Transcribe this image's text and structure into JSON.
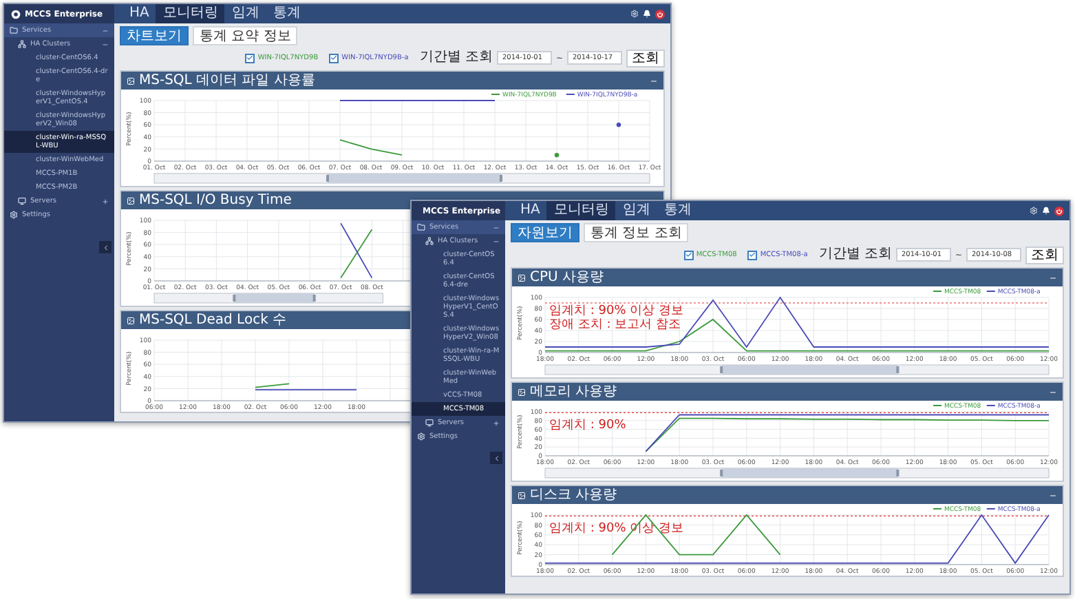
{
  "windows": [
    {
      "logo": "MCCS Enterprise",
      "nav_tabs": [
        {
          "label": "HA",
          "selected": false
        },
        {
          "label": "모니터링",
          "selected": true
        },
        {
          "label": "임계",
          "selected": false
        },
        {
          "label": "통계",
          "selected": false
        }
      ],
      "sidebar": [
        {
          "label": "Services",
          "kind": "section",
          "expanded": true,
          "selected": false,
          "children": [
            {
              "label": "HA Clusters",
              "kind": "group",
              "expanded": true,
              "selected": false,
              "children": [
                {
                  "label": "cluster-CentOS6.4",
                  "kind": "node",
                  "selected": false
                },
                {
                  "label": "cluster-CentOS6.4-dre",
                  "kind": "node",
                  "selected": false
                },
                {
                  "label": "cluster-WindowsHyperV1_CentOS.4",
                  "kind": "node",
                  "selected": false
                },
                {
                  "label": "cluster-WindowsHyperV2_Win08",
                  "kind": "node",
                  "selected": false
                },
                {
                  "label": "cluster-Win-ra-MSSQL-WBU",
                  "kind": "node",
                  "selected": true
                },
                {
                  "label": "cluster-WinWebMed",
                  "kind": "node",
                  "selected": false
                },
                {
                  "label": "MCCS-PM1B",
                  "kind": "node",
                  "selected": false
                },
                {
                  "label": "MCCS-PM2B",
                  "kind": "node",
                  "selected": false
                }
              ]
            },
            {
              "label": "Servers",
              "kind": "device",
              "expanded": false,
              "selected": false
            }
          ]
        },
        {
          "label": "Settings",
          "kind": "link",
          "selected": false
        }
      ],
      "sub_tabs": [
        {
          "label": "차트보기",
          "selected": true
        },
        {
          "label": "통계 요약 정보",
          "selected": false
        }
      ],
      "filters": [
        {
          "label": "WIN-7IQL7NYD9B",
          "checked": true,
          "color": "#3a9a3a"
        },
        {
          "label": "WIN-7IQL7NYD9B-a",
          "checked": true,
          "color": "#4a4ab8"
        }
      ],
      "period_label": "기간별 조회",
      "date_from": "2014-10-01",
      "date_sep": "~",
      "date_to": "2014-10-17",
      "query_button": "조회",
      "panels": [
        {
          "title": "MS-SQL 데이터 파일 사용률",
          "navigator": true,
          "minimize": true,
          "chart_data": {
            "type": "line",
            "ylabel": "Percent(%)",
            "yticks": [
              0,
              20,
              40,
              60,
              80,
              100
            ],
            "ylim": [
              0,
              100
            ],
            "grid": true,
            "legend": "upper right",
            "categories": [
              "01. Oct",
              "02. Oct",
              "03. Oct",
              "04. Oct",
              "05. Oct",
              "06. Oct",
              "07. Oct",
              "08. Oct",
              "09. Oct",
              "10. Oct",
              "11. Oct",
              "12. Oct",
              "13. Oct",
              "14. Oct",
              "15. Oct",
              "16. Oct",
              "17. Oct"
            ],
            "series": [
              {
                "name": "WIN-7IQL7NYD9B",
                "color": "#3a9a3a",
                "values": [
                  null,
                  null,
                  null,
                  null,
                  null,
                  null,
                  35,
                  20,
                  10,
                  null,
                  null,
                  null,
                  null,
                  10,
                  null,
                  null,
                  null
                ]
              },
              {
                "name": "WIN-7IQL7NYD9B-a",
                "color": "#4a4ab8",
                "values": [
                  null,
                  null,
                  null,
                  null,
                  null,
                  null,
                  100,
                  100,
                  100,
                  100,
                  100,
                  100,
                  null,
                  null,
                  null,
                  60,
                  null
                ]
              }
            ]
          }
        },
        {
          "title": "MS-SQL I/O Busy Time",
          "navigator": true,
          "chart_data": {
            "type": "line",
            "ylabel": "Percent(%)",
            "yticks": [
              0,
              20,
              40,
              60,
              80,
              100
            ],
            "ylim": [
              0,
              100
            ],
            "grid": true,
            "categories": [
              "01. Oct",
              "02. Oct",
              "03. Oct",
              "04. Oct",
              "05. Oct",
              "06. Oct",
              "07. Oct",
              "08. Oct"
            ],
            "series": [
              {
                "color": "#3a9a3a",
                "values": [
                  null,
                  null,
                  null,
                  null,
                  null,
                  null,
                  5,
                  85
                ]
              },
              {
                "color": "#4a4ab8",
                "values": [
                  null,
                  null,
                  null,
                  null,
                  null,
                  null,
                  95,
                  5
                ]
              }
            ]
          }
        },
        {
          "title": "MS-SQL Dead Lock 수",
          "chart_data": {
            "type": "line",
            "ylabel": "Percent(%)",
            "yticks": [
              0,
              20,
              40,
              60,
              80,
              100
            ],
            "ylim": [
              0,
              100
            ],
            "grid": true,
            "categories": [
              "06:00",
              "12:00",
              "18:00",
              "02. Oct",
              "06:00",
              "12:00",
              "18:00"
            ],
            "series": [
              {
                "color": "#3a9a3a",
                "values": [
                  null,
                  null,
                  null,
                  22,
                  28,
                  null,
                  null
                ]
              },
              {
                "color": "#4a4ab8",
                "values": [
                  null,
                  null,
                  null,
                  18,
                  18,
                  18,
                  18
                ]
              }
            ]
          }
        }
      ]
    },
    {
      "logo": "MCCS Enterprise",
      "nav_tabs": [
        {
          "label": "HA",
          "selected": false
        },
        {
          "label": "모니터링",
          "selected": true
        },
        {
          "label": "임계",
          "selected": false
        },
        {
          "label": "통계",
          "selected": false
        }
      ],
      "sidebar": [
        {
          "label": "Services",
          "kind": "section",
          "expanded": true,
          "selected": false,
          "children": [
            {
              "label": "HA Clusters",
              "kind": "group",
              "expanded": true,
              "selected": false,
              "children": [
                {
                  "label": "cluster-CentOS6.4",
                  "kind": "node",
                  "selected": false
                },
                {
                  "label": "cluster-CentOS6.4-dre",
                  "kind": "node",
                  "selected": false
                },
                {
                  "label": "cluster-WindowsHyperV1_CentOS.4",
                  "kind": "node",
                  "selected": false
                },
                {
                  "label": "cluster-WindowsHyperV2_Win08",
                  "kind": "node",
                  "selected": false
                },
                {
                  "label": "cluster-Win-ra-MSSQL-WBU",
                  "kind": "node",
                  "selected": false
                },
                {
                  "label": "cluster-WinWebMed",
                  "kind": "node",
                  "selected": false
                },
                {
                  "label": "vCCS-TM08",
                  "kind": "node",
                  "selected": false
                },
                {
                  "label": "MCCS-TM08",
                  "kind": "node",
                  "selected": true
                }
              ]
            },
            {
              "label": "Servers",
              "kind": "device",
              "expanded": false,
              "selected": false
            }
          ]
        },
        {
          "label": "Settings",
          "kind": "link",
          "selected": false
        }
      ],
      "sub_tabs": [
        {
          "label": "자원보기",
          "selected": true
        },
        {
          "label": "통계 정보 조회",
          "selected": false
        }
      ],
      "filters": [
        {
          "label": "MCCS-TM08",
          "checked": true,
          "color": "#3a9a3a"
        },
        {
          "label": "MCCS-TM08-a",
          "checked": true,
          "color": "#4a4ab8"
        }
      ],
      "period_label": "기간별 조회",
      "date_from": "2014-10-01",
      "date_sep": "~",
      "date_to": "2014-10-08",
      "query_button": "조회",
      "panels": [
        {
          "title": "CPU 사용량",
          "navigator": true,
          "minimize": true,
          "chart_data": {
            "type": "line",
            "ylabel": "Percent(%)",
            "yticks": [
              0,
              20,
              40,
              60,
              80,
              100
            ],
            "ylim": [
              0,
              100
            ],
            "grid": true,
            "legend": "upper right",
            "categories": [
              "18:00",
              "02. Oct",
              "06:00",
              "12:00",
              "18:00",
              "03. Oct",
              "06:00",
              "12:00",
              "18:00",
              "04. Oct",
              "06:00",
              "12:00",
              "18:00",
              "05. Oct",
              "06:00",
              "12:00"
            ],
            "series": [
              {
                "name": "MCCS-TM08",
                "color": "#3a9a3a",
                "values": [
                  3,
                  3,
                  3,
                  3,
                  20,
                  60,
                  3,
                  3,
                  3,
                  3,
                  3,
                  3,
                  3,
                  3,
                  3,
                  3
                ]
              },
              {
                "name": "MCCS-TM08-a",
                "color": "#4a4ab8",
                "values": [
                  10,
                  10,
                  10,
                  10,
                  15,
                  95,
                  10,
                  100,
                  10,
                  10,
                  10,
                  10,
                  10,
                  10,
                  10,
                  10
                ]
              }
            ],
            "ref_lines": [
              {
                "axis": "y",
                "value": 90,
                "color": "#e03030"
              }
            ],
            "annotations": [
              "임계치 : 90% 이상 경보",
              "장애 조치 : 보고서 참조"
            ]
          }
        },
        {
          "title": "메모리 사용량",
          "navigator": true,
          "minimize": true,
          "chart_data": {
            "type": "line",
            "ylabel": "Percent(%)",
            "yticks": [
              0,
              20,
              40,
              60,
              80,
              100
            ],
            "ylim": [
              0,
              100
            ],
            "grid": true,
            "legend": "upper right",
            "categories": [
              "18:00",
              "02. Oct",
              "06:00",
              "12:00",
              "18:00",
              "03. Oct",
              "06:00",
              "12:00",
              "18:00",
              "04. Oct",
              "06:00",
              "12:00",
              "18:00",
              "05. Oct",
              "06:00",
              "12:00"
            ],
            "series": [
              {
                "name": "MCCS-TM08",
                "color": "#3a9a3a",
                "values": [
                  null,
                  null,
                  null,
                  10,
                  85,
                  85,
                  84,
                  84,
                  83,
                  83,
                  82,
                  82,
                  81,
                  81,
                  80,
                  80
                ]
              },
              {
                "name": "MCCS-TM08-a",
                "color": "#4a4ab8",
                "values": [
                  null,
                  null,
                  null,
                  10,
                  93,
                  93,
                  93,
                  93,
                  93,
                  93,
                  93,
                  93,
                  93,
                  93,
                  93,
                  93
                ]
              }
            ],
            "ref_lines": [
              {
                "axis": "y",
                "value": 98,
                "color": "#e03030"
              }
            ],
            "annotations": [
              "임계치 : 90%"
            ]
          }
        },
        {
          "title": "디스크 사용량",
          "minimize": true,
          "chart_data": {
            "type": "line",
            "ylabel": "Percent(%)",
            "yticks": [
              0,
              20,
              40,
              60,
              80,
              100
            ],
            "ylim": [
              0,
              100
            ],
            "grid": true,
            "legend": "upper right",
            "categories": [
              "18:00",
              "02. Oct",
              "06:00",
              "12:00",
              "18:00",
              "03. Oct",
              "06:00",
              "12:00",
              "18:00",
              "04. Oct",
              "06:00",
              "12:00",
              "18:00",
              "05. Oct",
              "06:00",
              "12:00"
            ],
            "series": [
              {
                "name": "MCCS-TM08",
                "color": "#3a9a3a",
                "values": [
                  null,
                  null,
                  20,
                  100,
                  20,
                  20,
                  100,
                  20,
                  null,
                  null,
                  null,
                  null,
                  null,
                  null,
                  null,
                  null
                ]
              },
              {
                "name": "MCCS-TM08-a",
                "color": "#4a4ab8",
                "values": [
                  3,
                  3,
                  3,
                  3,
                  3,
                  3,
                  3,
                  3,
                  3,
                  3,
                  3,
                  3,
                  3,
                  100,
                  3,
                  100
                ]
              }
            ],
            "ref_lines": [
              {
                "axis": "y",
                "value": 98,
                "color": "#e03030"
              }
            ],
            "annotations": [
              "임계치 : 90% 이상 경보"
            ]
          }
        }
      ]
    }
  ]
}
